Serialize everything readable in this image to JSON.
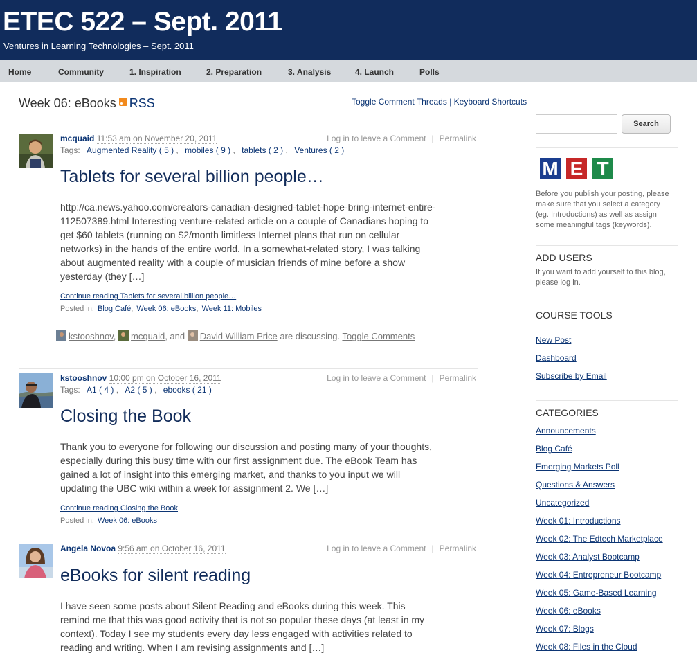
{
  "header": {
    "site_title": "ETEC 522 – Sept. 2011",
    "site_description": "Ventures in Learning Technologies – Sept. 2011"
  },
  "nav": {
    "items": [
      "Home",
      "Community",
      "1. Inspiration",
      "2. Preparation",
      "3. Analysis",
      "4. Launch",
      "Polls"
    ]
  },
  "page": {
    "heading": "Week 06: eBooks",
    "rss_label": "RSS",
    "toggle_threads": "Toggle Comment Threads",
    "separator": "|",
    "keyboard_shortcuts": "Keyboard Shortcuts"
  },
  "posts": [
    {
      "author": "mcquaid",
      "time": "11:53 am on November 20, 2011",
      "actions": {
        "comment": "Log in to leave a Comment",
        "sep": "|",
        "permalink": "Permalink"
      },
      "tags_label": "Tags:",
      "tags": [
        "Augmented Reality ( 5 )",
        "mobiles ( 9 )",
        "tablets ( 2 )",
        "Ventures ( 2 )"
      ],
      "title": "Tablets for several billion people…",
      "excerpt": "http://ca.news.yahoo.com/creators-canadian-designed-tablet-hope-bring-internet-entire-112507389.html Interesting venture-related article on a couple of Canadians hoping to get $60 tablets (running on $2/month limitless Internet plans that run on cellular networks) in the hands of the entire world. In a somewhat-related story, I was talking about augmented reality with a couple of musician friends of mine before a show yesterday (they […]",
      "continue": "Continue reading Tablets for several billion people…",
      "posted_in_label": "Posted in:",
      "categories": [
        "Blog Café",
        "Week 06: eBooks",
        "Week 11: Mobiles"
      ],
      "discussing": {
        "people": [
          "kstooshnov",
          "mcquaid",
          "David William Price"
        ],
        "comma": ",",
        "and": ", and",
        "suffix": "are discussing.",
        "toggle": "Toggle Comments"
      }
    },
    {
      "author": "kstooshnov",
      "time": "10:00 pm on October 16, 2011",
      "actions": {
        "comment": "Log in to leave a Comment",
        "sep": "|",
        "permalink": "Permalink"
      },
      "tags_label": "Tags:",
      "tags": [
        "A1 ( 4 )",
        "A2 ( 5 )",
        "ebooks ( 21 )"
      ],
      "title": "Closing the Book",
      "excerpt": "Thank you to everyone for following our discussion and posting many of your thoughts, especially during this busy time with our first assignment due.  The eBook Team has gained a lot of insight into this emerging market, and thanks to you input we will updating the UBC wiki within a week for assignment 2. We […]",
      "continue": "Continue reading Closing the Book",
      "posted_in_label": "Posted in:",
      "categories": [
        "Week 06: eBooks"
      ]
    },
    {
      "author": "Angela Novoa",
      "time": "9:56 am on October 16, 2011",
      "actions": {
        "comment": "Log in to leave a Comment",
        "sep": "|",
        "permalink": "Permalink"
      },
      "title": "eBooks for silent reading",
      "excerpt": "I have seen some posts about Silent Reading and eBooks during this week. This remind me that this was good activity that is not so popular these days (at least in my context). Today I see my students every day less engaged with activities related to reading and writing. When I am revising assignments and […]"
    }
  ],
  "sidebar": {
    "search": {
      "button": "Search",
      "value": ""
    },
    "logo_letters": [
      "M",
      "E",
      "T"
    ],
    "logo_colors": [
      "#1a3d8f",
      "#c62828",
      "#1e8a4a"
    ],
    "notice": "Before you publish your posting, please make sure that you select a category (eg. Introductions) as well as assign some meaningful tags (keywords).",
    "add_users": {
      "heading": "ADD USERS",
      "text": "If you want to add yourself to this blog, please log in."
    },
    "course_tools": {
      "heading": "COURSE TOOLS",
      "links": [
        "New Post",
        "Dashboard",
        "Subscribe by Email"
      ]
    },
    "categories": {
      "heading": "CATEGORIES",
      "links": [
        "Announcements",
        "Blog Café",
        "Emerging Markets Poll",
        "Questions & Answers",
        "Uncategorized",
        "Week 01: Introductions",
        "Week 02: The Edtech Marketplace",
        "Week 03: Analyst Bootcamp",
        "Week 04: Entrepreneur Bootcamp",
        "Week 05: Game-Based Learning",
        "Week 06: eBooks",
        "Week 07: Blogs",
        "Week 08: Files in the Cloud"
      ]
    }
  },
  "colors": {
    "header_bg": "#112c5c",
    "nav_bg": "#d5d9dd",
    "link": "#0c3574",
    "rss": "#f28a1d"
  }
}
